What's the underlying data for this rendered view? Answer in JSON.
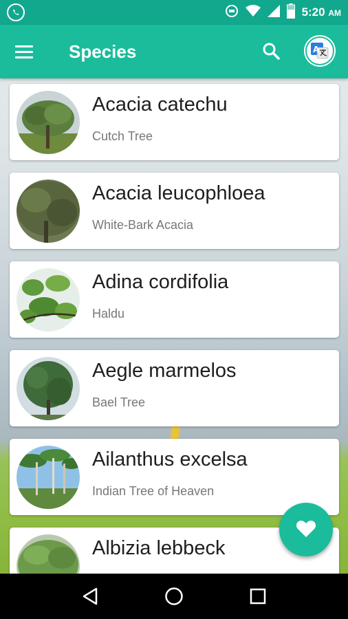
{
  "status_bar": {
    "time": "5:20",
    "ampm": "AM",
    "icons": [
      "whatsapp-icon",
      "sync-icon",
      "wifi-icon",
      "signal-icon",
      "battery-icon"
    ]
  },
  "app_bar": {
    "title": "Species",
    "menu_icon": "hamburger-menu-icon",
    "search_icon": "search-icon",
    "translate_icon": "translate-icon",
    "translate_glyph": "A"
  },
  "species": [
    {
      "name": "Acacia catechu",
      "common": "Cutch Tree",
      "thumb": "acacia-catechu-photo"
    },
    {
      "name": "Acacia leucophloea",
      "common": "White-Bark Acacia",
      "thumb": "acacia-leucophloea-photo"
    },
    {
      "name": "Adina cordifolia",
      "common": "Haldu",
      "thumb": "adina-cordifolia-photo"
    },
    {
      "name": "Aegle marmelos",
      "common": "Bael Tree",
      "thumb": "aegle-marmelos-photo"
    },
    {
      "name": "Ailanthus excelsa",
      "common": "Indian Tree of Heaven",
      "thumb": "ailanthus-excelsa-photo"
    },
    {
      "name": "Albizia lebbeck",
      "common": "",
      "thumb": "albizia-lebbeck-photo"
    }
  ],
  "fab": {
    "icon": "heart-icon"
  },
  "nav": {
    "back": "back-icon",
    "home": "home-icon",
    "recents": "recents-icon"
  },
  "colors": {
    "primary": "#1abc9c",
    "status_bar": "#11a88e"
  }
}
